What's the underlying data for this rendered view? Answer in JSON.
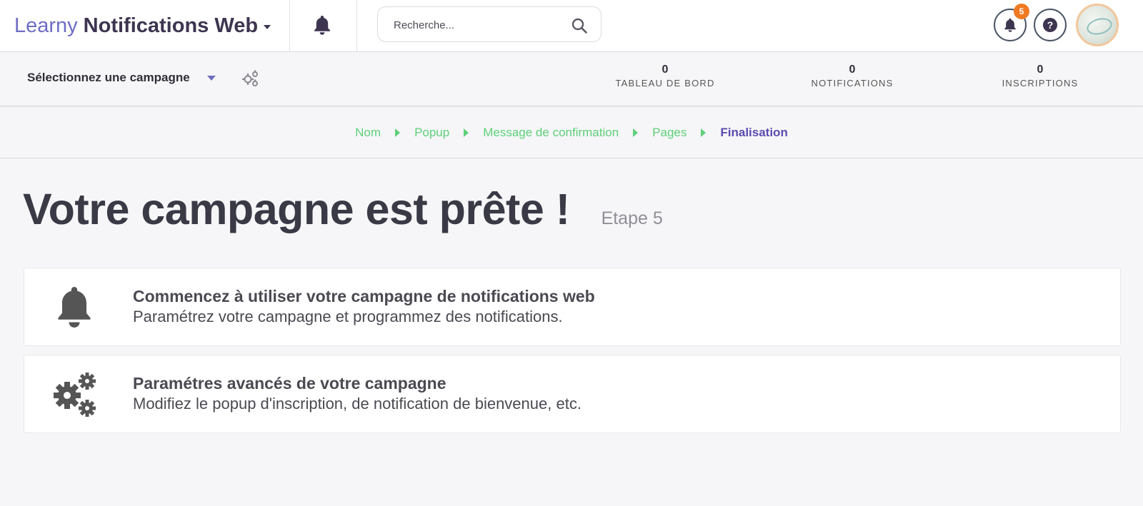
{
  "header": {
    "brand_light": "Learny",
    "brand_dark": "Notifications Web",
    "search_placeholder": "Recherche...",
    "notification_count": "5",
    "help_label": "?",
    "icons": [
      "bell-icon",
      "search-icon",
      "notification-bell-icon",
      "help-icon",
      "avatar"
    ]
  },
  "subbar": {
    "campaign_select_label": "Sélectionnez une campagne",
    "stats": [
      {
        "value": "0",
        "label": "TABLEAU DE BORD"
      },
      {
        "value": "0",
        "label": "NOTIFICATIONS"
      },
      {
        "value": "0",
        "label": "INSCRIPTIONS"
      }
    ]
  },
  "breadcrumb": {
    "steps": [
      "Nom",
      "Popup",
      "Message de confirmation",
      "Pages",
      "Finalisation"
    ],
    "active_index": 4
  },
  "main": {
    "title": "Votre campagne est prête !",
    "step_label": "Etape 5",
    "cards": [
      {
        "icon": "bell-icon",
        "title": "Commencez à utiliser votre campagne de notifications web",
        "description": "Paramétrez votre campagne et programmez des notifications."
      },
      {
        "icon": "gears-icon",
        "title": "Paramétres avancés de votre campagne",
        "description": "Modifiez le popup d'inscription, de notification de bienvenue, etc."
      }
    ]
  },
  "colors": {
    "brand_light": "#6e6ec4",
    "brand_dark": "#3d3550",
    "crumb_done": "#5ed07a",
    "crumb_active": "#5b4bb0",
    "badge": "#f07a22"
  }
}
